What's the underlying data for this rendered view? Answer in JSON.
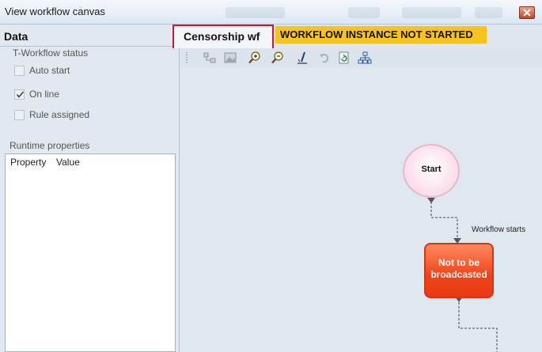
{
  "window": {
    "title": "View workflow canvas"
  },
  "left_panel": {
    "title": "Data",
    "group_label": "T-Workflow status",
    "checkboxes": [
      {
        "label": "Auto start",
        "checked": false
      },
      {
        "label": "On line",
        "checked": true
      },
      {
        "label": "Rule assigned",
        "checked": false
      }
    ],
    "runtime_label": "Runtime properties",
    "table": {
      "columns": [
        "Property",
        "Value"
      ],
      "rows": []
    }
  },
  "workflow_tab": {
    "label": "Censorship wf",
    "status": "WORKFLOW INSTANCE NOT STARTED"
  },
  "toolbar": {
    "icons": [
      "connect-icon",
      "image-icon",
      "zoom-in-icon",
      "zoom-out-icon",
      "pointer-icon",
      "undo-icon",
      "refresh-icon",
      "layout-tree-icon"
    ]
  },
  "canvas": {
    "nodes": {
      "start": "Start",
      "task": "Not to be\nbroadcasted"
    },
    "edge_label": "Workflow starts"
  },
  "colors": {
    "status_badge": "#f9c31f",
    "task_node": "#f0431b",
    "start_node": "#fbe3ee",
    "active_tab_border": "#d0182a"
  }
}
